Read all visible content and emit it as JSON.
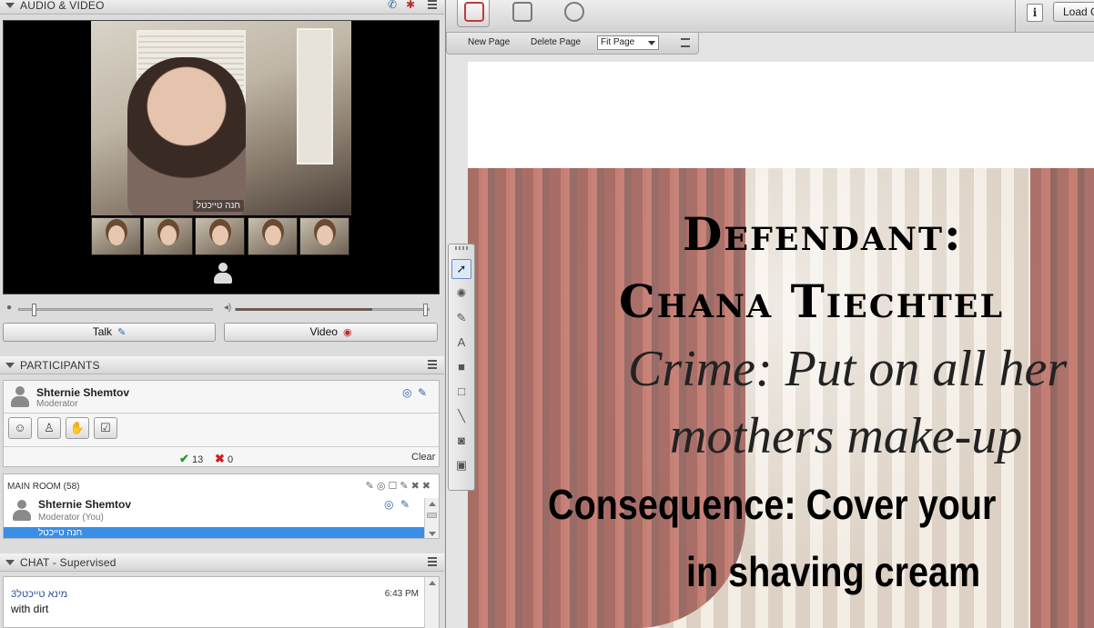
{
  "audio_video": {
    "title": "AUDIO & VIDEO",
    "main_camera_label": "חנה טייכטל",
    "talk_label": "Talk",
    "video_label": "Video",
    "thumbnails": 5
  },
  "participants": {
    "title": "PARTICIPANTS",
    "me": {
      "name": "Shternie Shemtov",
      "role": "Moderator"
    },
    "tally_yes": "13",
    "tally_no": "0",
    "clear_label": "Clear",
    "room_title": "MAIN ROOM",
    "room_count": "(58)",
    "list": [
      {
        "name": "Shternie Shemtov",
        "role": "Moderator (You)"
      },
      {
        "name": "חנה טייכטל",
        "role": ""
      }
    ]
  },
  "chat": {
    "title": "CHAT - Supervised",
    "sender": "מינא טייכטל3",
    "time": "6:43 PM",
    "message": "with dirt"
  },
  "whiteboard": {
    "new_page": "New Page",
    "delete_page": "Delete Page",
    "fit_option": "Fit Page",
    "load_label": "Load C",
    "info_label": "i",
    "slide": {
      "line1": "Defendant:",
      "line2": "Chana Tiechtel",
      "line3": "Crime: Put on all her",
      "line4": "mothers make-up",
      "line5": "Consequence: Cover your",
      "line6": "in shaving cream"
    }
  },
  "colors": {
    "selection_blue": "#3a8ee6",
    "check_green": "#2a9a2a",
    "cross_red": "#d02020"
  }
}
